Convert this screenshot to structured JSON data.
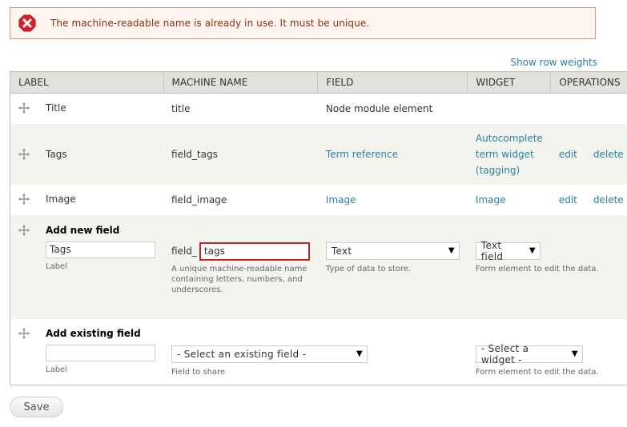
{
  "message": {
    "type": "error",
    "icon": "error-icon",
    "text": "The machine-readable name is already in use. It must be unique."
  },
  "show_row_weights": "Show row weights",
  "table": {
    "headers": [
      "LABEL",
      "MACHINE NAME",
      "FIELD",
      "WIDGET",
      "OPERATIONS"
    ],
    "rows": [
      {
        "label": "Title",
        "machine_name": "title",
        "field": "Node module element",
        "widget": "",
        "edit": "",
        "delete": ""
      },
      {
        "label": "Tags",
        "machine_name": "field_tags",
        "field": "Term reference",
        "widget": "Autocomplete term widget (tagging)",
        "widget_lines": [
          "Autocomplete",
          "term widget",
          "(tagging)"
        ],
        "edit": "edit",
        "delete": "delete"
      },
      {
        "label": "Image",
        "machine_name": "field_image",
        "field": "Image",
        "widget": "Image",
        "edit": "edit",
        "delete": "delete"
      }
    ],
    "add_new": {
      "title": "Add new field",
      "label_value": "Tags",
      "label_caption": "Label",
      "machine_prefix": "field_",
      "machine_value": "tags",
      "machine_desc": [
        "A unique machine-readable name",
        "containing letters, numbers, and",
        "underscores."
      ],
      "field_type": "Text",
      "field_type_desc": "Type of data to store.",
      "widget": "Text field",
      "widget_desc": "Form element to edit the data."
    },
    "add_existing": {
      "title": "Add existing field",
      "label_value": "",
      "label_caption": "Label",
      "field_select": "- Select an existing field -",
      "field_desc": "Field to share",
      "widget_select": "- Select a widget -",
      "widget_desc": "Form element to edit the data."
    }
  },
  "save_label": "Save",
  "colors": {
    "error_bg": "#fef5f1",
    "error_text": "#8c2e0b",
    "link": "#2a7fa6",
    "error_border_input": "#c8242a"
  }
}
